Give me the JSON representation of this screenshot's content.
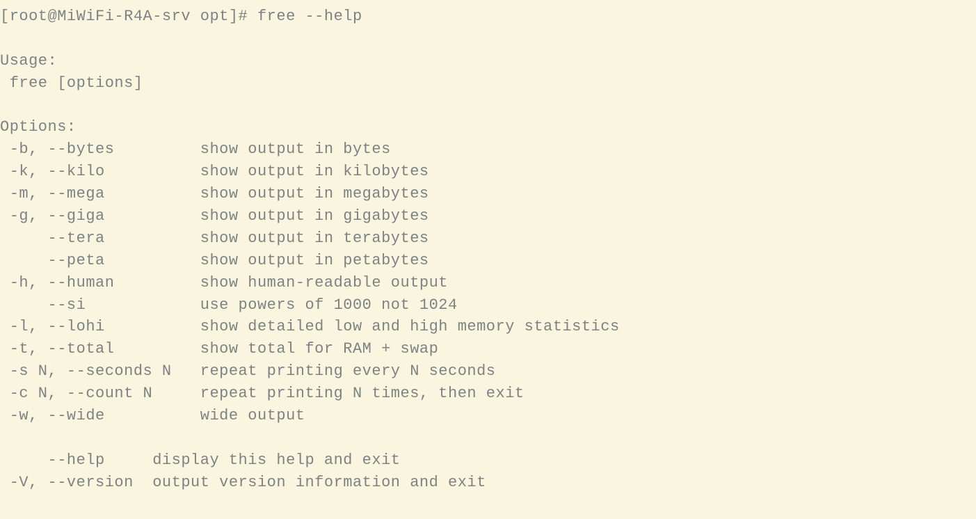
{
  "terminal": {
    "prompt": "[root@MiWiFi-R4A-srv opt]# ",
    "command": "free --help",
    "blank1": "",
    "usage_header": "Usage:",
    "usage_line": " free [options]",
    "blank2": "",
    "options_header": "Options:",
    "opt_b": " -b, --bytes         show output in bytes",
    "opt_k": " -k, --kilo          show output in kilobytes",
    "opt_m": " -m, --mega          show output in megabytes",
    "opt_g": " -g, --giga          show output in gigabytes",
    "opt_tera": "     --tera          show output in terabytes",
    "opt_peta": "     --peta          show output in petabytes",
    "opt_h": " -h, --human         show human-readable output",
    "opt_si": "     --si            use powers of 1000 not 1024",
    "opt_l": " -l, --lohi          show detailed low and high memory statistics",
    "opt_t": " -t, --total         show total for RAM + swap",
    "opt_s": " -s N, --seconds N   repeat printing every N seconds",
    "opt_c": " -c N, --count N     repeat printing N times, then exit",
    "opt_w": " -w, --wide          wide output",
    "blank3": "",
    "opt_help": "     --help     display this help and exit",
    "opt_v": " -V, --version  output version information and exit"
  }
}
